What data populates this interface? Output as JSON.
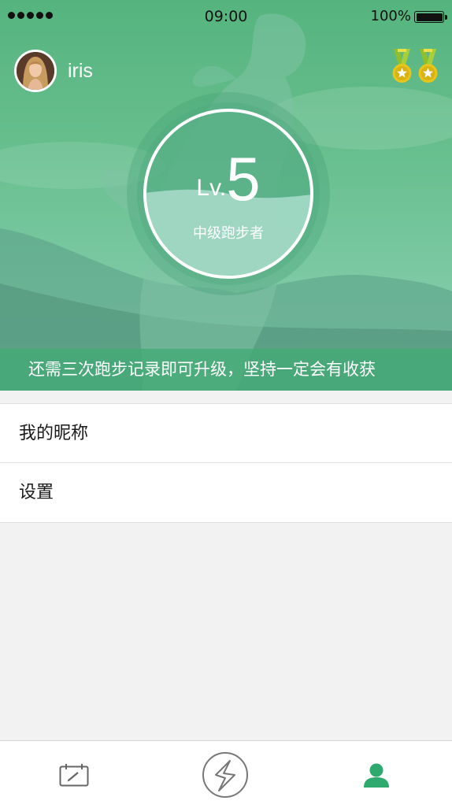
{
  "status_bar": {
    "time": "09:00",
    "battery_percent": "100%",
    "signal_bars": 5
  },
  "profile": {
    "username": "iris",
    "medal_count": 2,
    "medal_icon": "medal-icon"
  },
  "level": {
    "prefix": "Lv.",
    "number": "5",
    "rank": "中级跑步者",
    "progress_fraction": 0.5
  },
  "upgrade_hint": "还需三次跑步记录即可升级，坚持一定会有收获",
  "menu": {
    "items": [
      {
        "label": "我的昵称"
      },
      {
        "label": "设置"
      }
    ]
  },
  "tab_bar": {
    "tabs": [
      {
        "icon": "calendar-pen-icon",
        "active": false
      },
      {
        "icon": "run-logo-icon",
        "active": false
      },
      {
        "icon": "person-icon",
        "active": true
      }
    ],
    "active_color": "#2eaa6e",
    "inactive_color": "#666666"
  },
  "colors": {
    "brand_green": "#55b47e",
    "upgrade_bar": "#42aa74",
    "ring": "#ffffff",
    "background": "#f2f2f2"
  }
}
